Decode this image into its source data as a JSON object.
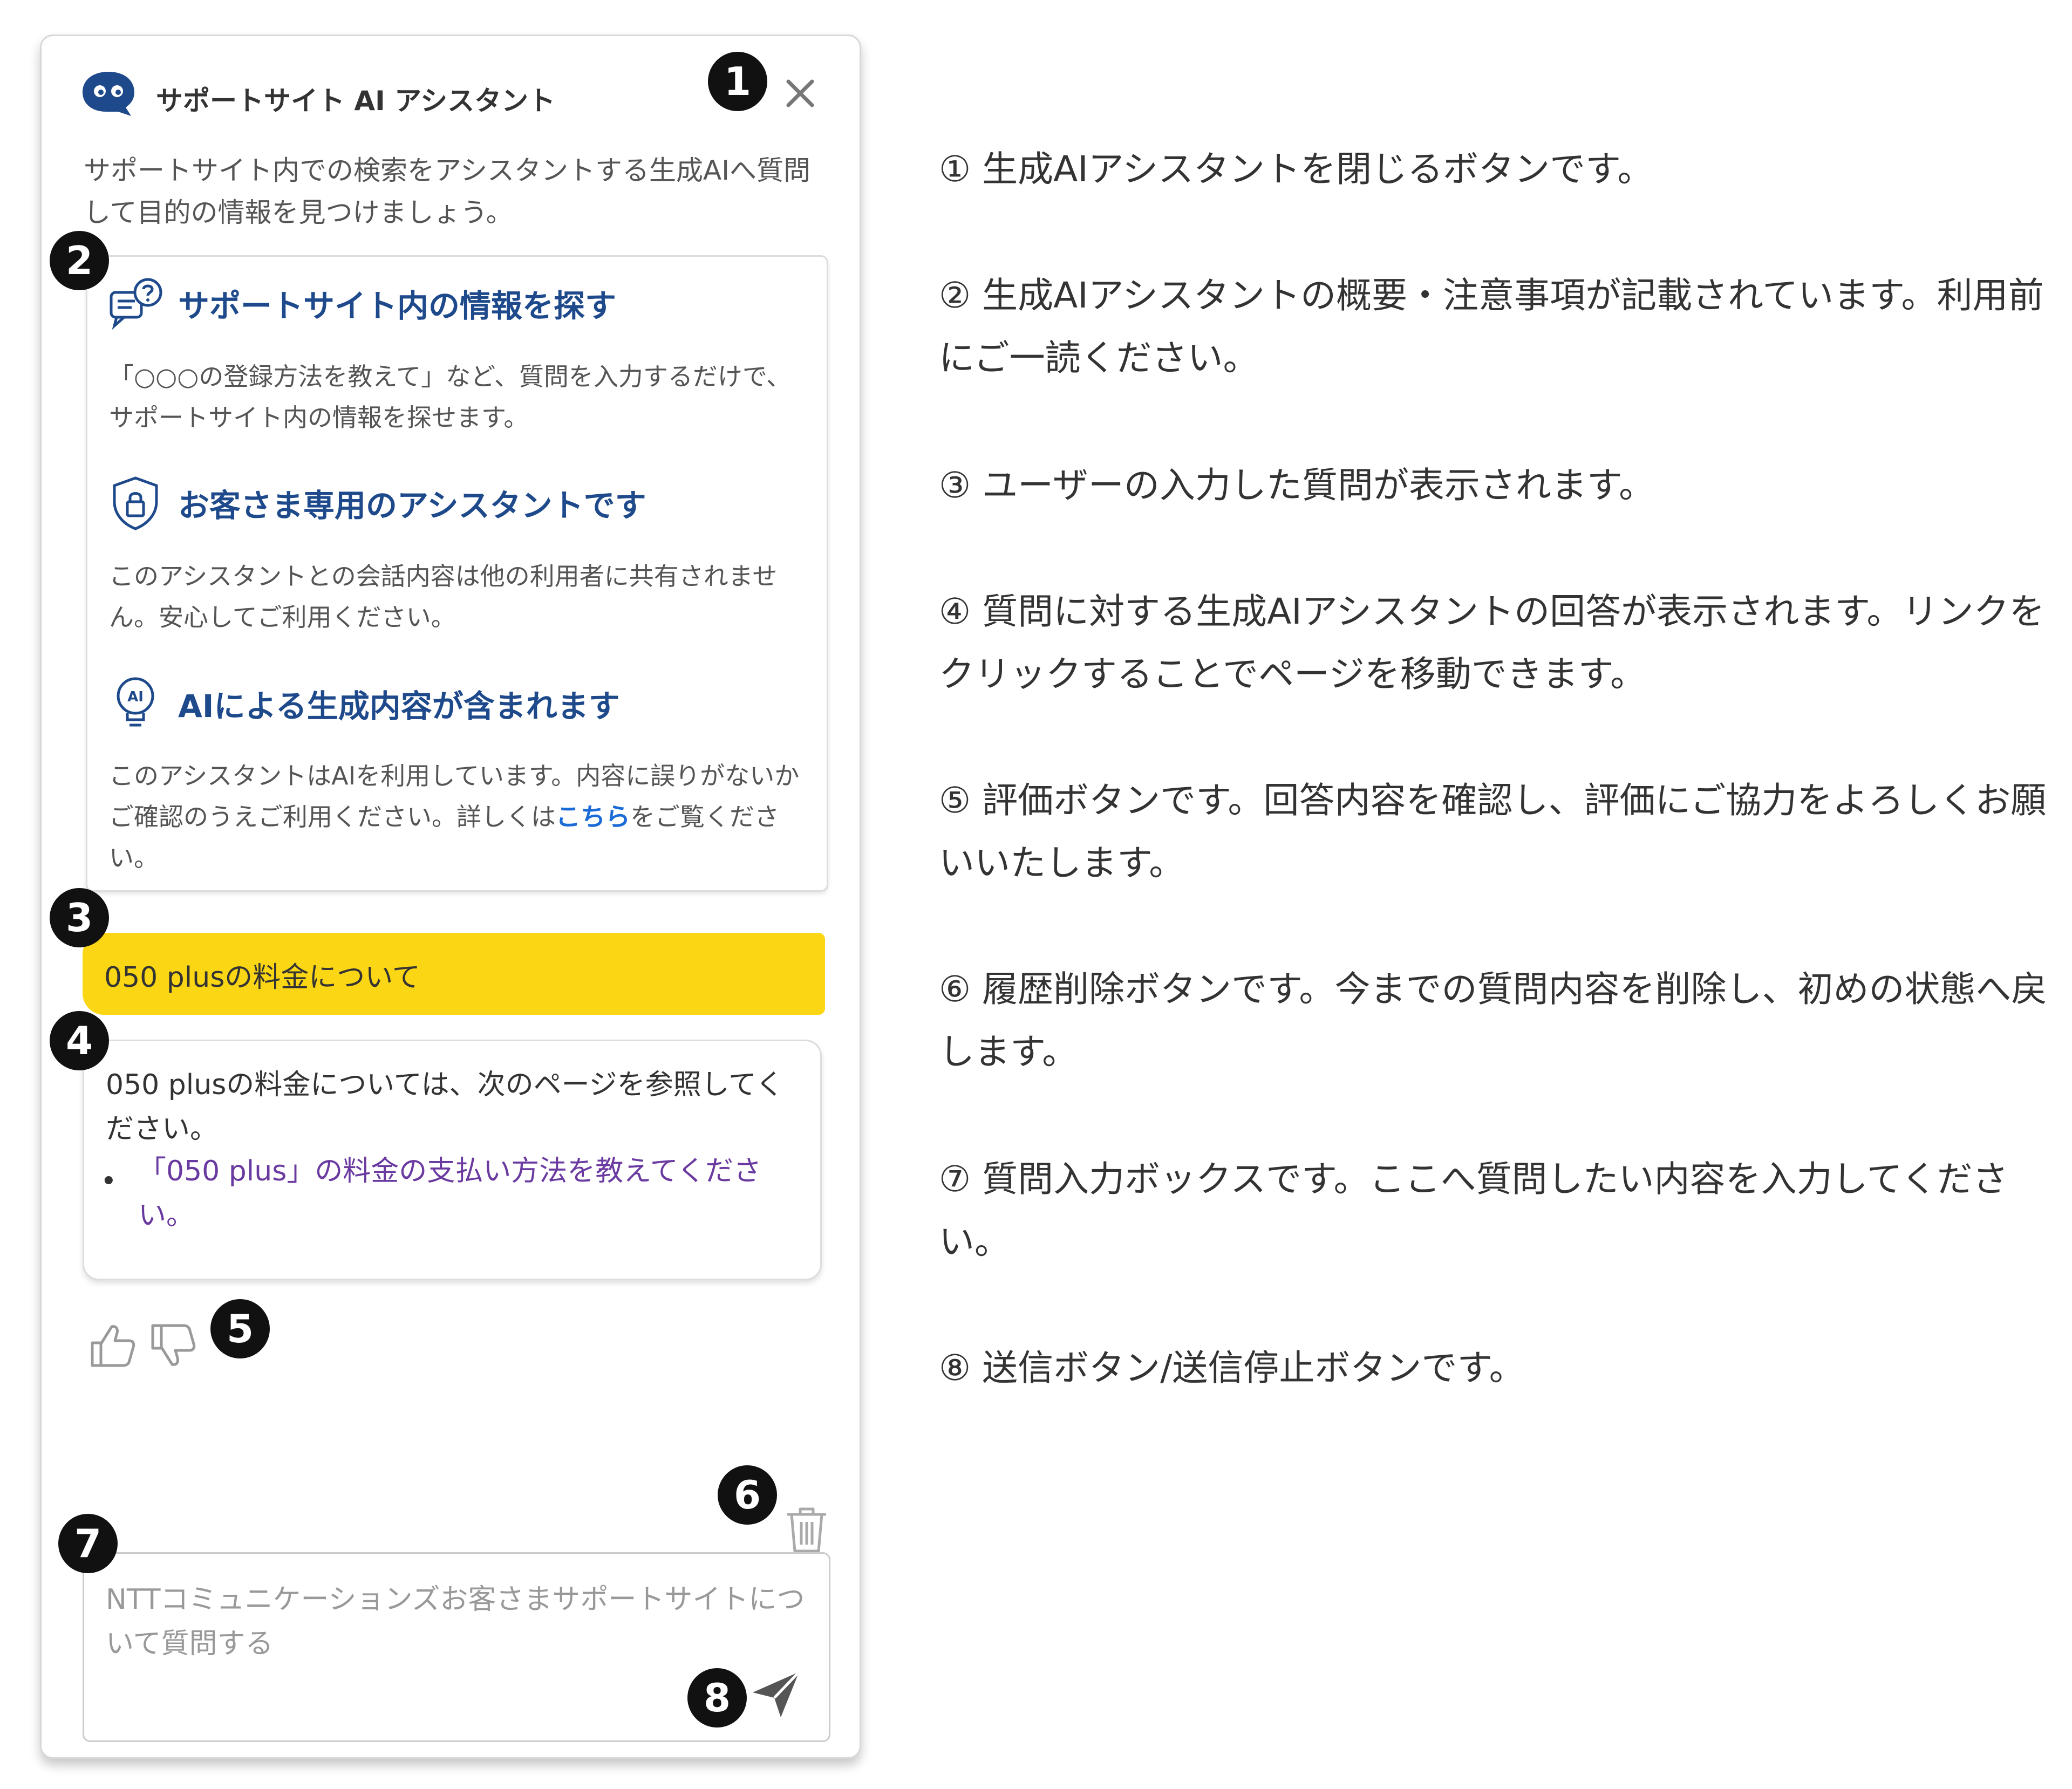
{
  "panel": {
    "title": "サポートサイト AI アシスタント",
    "intro": "サポートサイト内での検索をアシスタントする生成AIへ質問して目的の情報を見つけましょう。",
    "sections": [
      {
        "title": "サポートサイト内の情報を探す",
        "desc": "「○○○の登録方法を教えて」など、質問を入力するだけで、サポートサイト内の情報を探せます。"
      },
      {
        "title": "お客さま専用のアシスタントです",
        "desc": "このアシスタントとの会話内容は他の利用者に共有されません。安心してご利用ください。"
      },
      {
        "title": "AIによる生成内容が含まれます",
        "desc_before": "このアシスタントはAIを利用しています。内容に誤りがないかご確認のうえご利用ください。詳しくは",
        "desc_link": "こちら",
        "desc_after": "をご覧ください。"
      }
    ],
    "user_message": "050 plusの料金について",
    "answer": {
      "text": "050 plusの料金については、次のページを参照してください。",
      "bullet": "•",
      "link": "「050 plus」の料金の支払い方法を教えてください。"
    },
    "input_placeholder": "NTTコミュニケーションズお客さまサポートサイトについて質問する",
    "icons": {
      "logo": "chat-bot-logo-icon",
      "close": "close-icon",
      "search": "chat-question-icon",
      "shield": "shield-lock-icon",
      "ai": "ai-bulb-icon",
      "like": "thumbs-up-icon",
      "dislike": "thumbs-down-icon",
      "trash": "trash-icon",
      "send": "send-icon"
    }
  },
  "badges": [
    "1",
    "2",
    "3",
    "4",
    "5",
    "6",
    "7",
    "8"
  ],
  "explanations": [
    "① 生成AIアシスタントを閉じるボタンです。",
    "② 生成AIアシスタントの概要・注意事項が記載されています。利用前にご一読ください。",
    "③ ユーザーの入力した質問が表示されます。",
    "④ 質問に対する生成AIアシスタントの回答が表示されます。リンクをクリックすることでページを移動できます。",
    "⑤ 評価ボタンです。回答内容を確認し、評価にご協力をよろしくお願いいたします。",
    "⑥ 履歴削除ボタンです。今までの質問内容を削除し、初めの状態へ戻します。",
    "⑦ 質問入力ボックスです。ここへ質問したい内容を入力してください。",
    "⑧ 送信ボタン/送信停止ボタンです。"
  ],
  "colors": {
    "title_blue": "#1e4a8c",
    "link_blue": "#1a6bd6",
    "user_bubble": "#fad614",
    "answer_link": "#6a3aa0",
    "badge": "#111111"
  }
}
